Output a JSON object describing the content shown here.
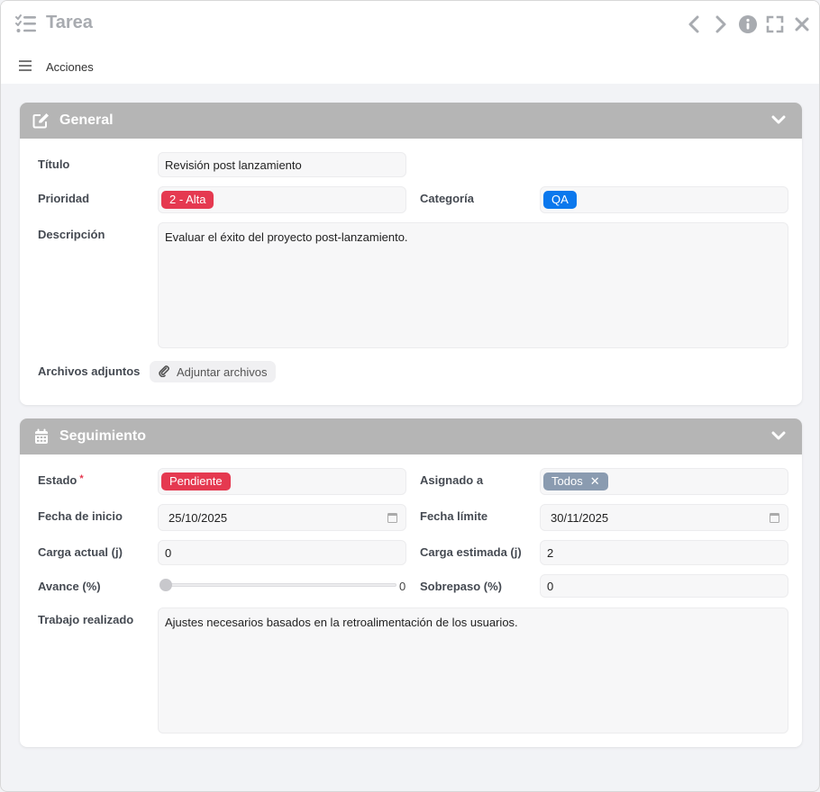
{
  "window": {
    "title": "Tarea",
    "controls": [
      "chevron-left-icon",
      "chevron-right-icon",
      "info-icon",
      "fullscreen-icon",
      "close-icon"
    ]
  },
  "toolbar": {
    "actions_label": "Acciones"
  },
  "general": {
    "header": "General",
    "titulo": {
      "label": "Título",
      "value": "Revisión post lanzamiento"
    },
    "prioridad": {
      "label": "Prioridad",
      "value": "2 - Alta",
      "color": "#e53950"
    },
    "categoria": {
      "label": "Categoría",
      "value": "QA",
      "color": "#0b78ed"
    },
    "descripcion": {
      "label": "Descripción",
      "value": "Evaluar el éxito del proyecto post-lanzamiento."
    },
    "adjuntos": {
      "label": "Archivos adjuntos",
      "button": "Adjuntar archivos"
    }
  },
  "seguimiento": {
    "header": "Seguimiento",
    "estado": {
      "label": "Estado",
      "required_mark": "*",
      "value": "Pendiente",
      "color": "#e53950"
    },
    "asignado": {
      "label": "Asignado a",
      "value": "Todos",
      "remove": "✕"
    },
    "fecha_inicio": {
      "label": "Fecha de inicio",
      "value": "25/10/2025"
    },
    "fecha_limite": {
      "label": "Fecha límite",
      "value": "30/11/2025"
    },
    "carga_actual": {
      "label": "Carga actual (j)",
      "value": "0"
    },
    "carga_estimada": {
      "label": "Carga estimada (j)",
      "value": "2"
    },
    "avance": {
      "label": "Avance (%)",
      "value": "0",
      "fraction": 0
    },
    "sobrepaso": {
      "label": "Sobrepaso (%)",
      "value": "0"
    },
    "trabajo": {
      "label": "Trabajo realizado",
      "value": "Ajustes necesarios basados en la retroalimentación de los usuarios."
    }
  }
}
